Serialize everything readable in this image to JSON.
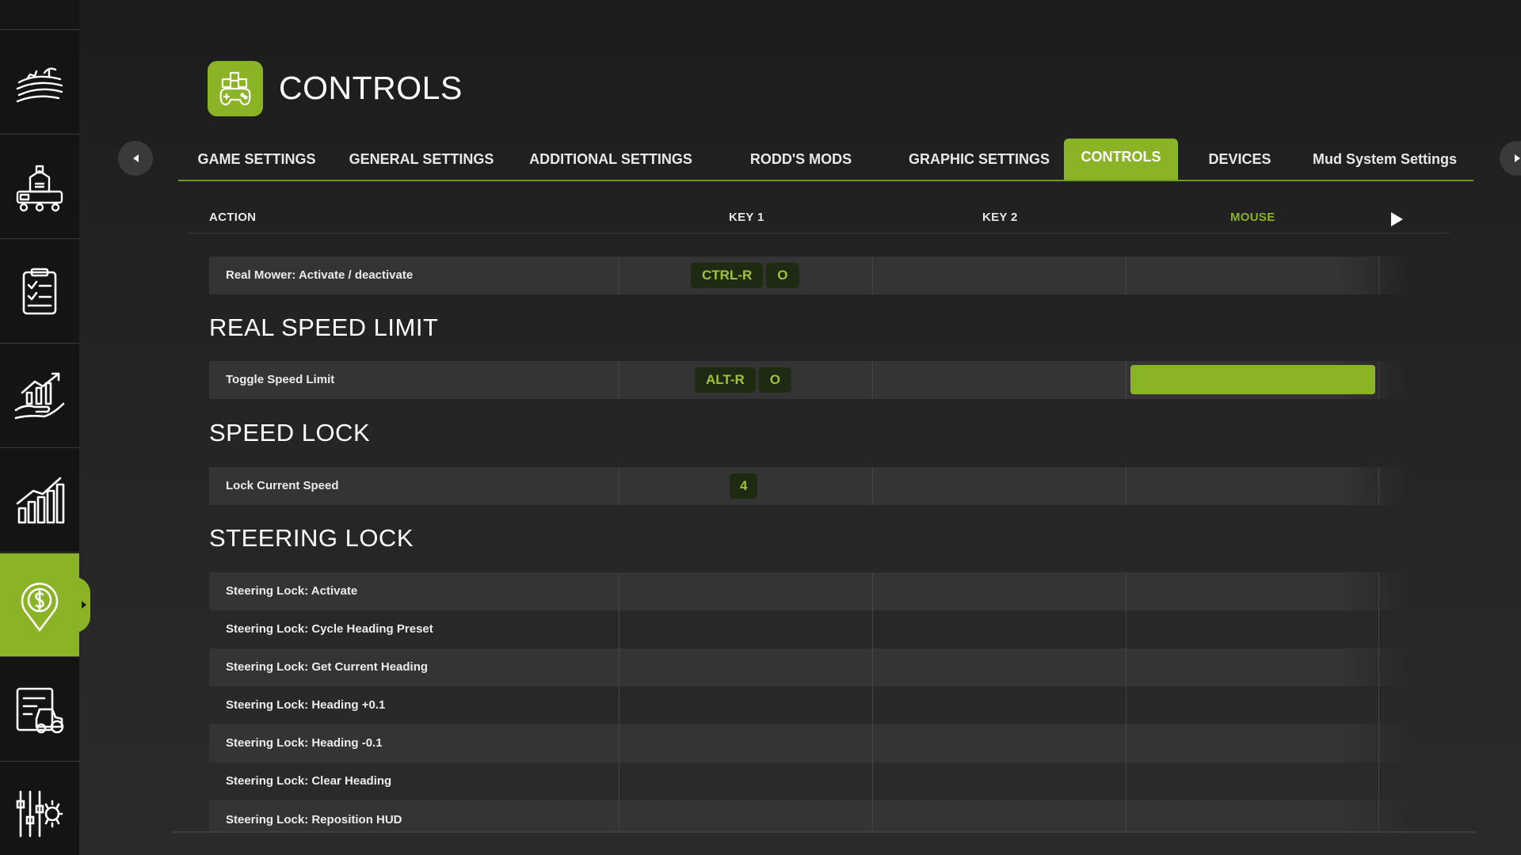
{
  "header": {
    "title": "CONTROLS",
    "icon": "gamepad-icon"
  },
  "sidebar": {
    "items": [
      {
        "name": "farmland-icon"
      },
      {
        "name": "production-icon"
      },
      {
        "name": "contracts-icon"
      },
      {
        "name": "finance-hand-icon"
      },
      {
        "name": "statistics-icon"
      },
      {
        "name": "map-price-icon",
        "active": true
      },
      {
        "name": "vehicle-list-icon"
      },
      {
        "name": "settings-sliders-icon"
      }
    ]
  },
  "tabs": [
    {
      "label": "GAME SETTINGS"
    },
    {
      "label": "GENERAL SETTINGS"
    },
    {
      "label": "ADDITIONAL SETTINGS"
    },
    {
      "label": "RODD'S MODS"
    },
    {
      "label": "GRAPHIC SETTINGS"
    },
    {
      "label": "CONTROLS",
      "active": true
    },
    {
      "label": "DEVICES"
    },
    {
      "label": "Mud System Settings"
    }
  ],
  "columns": {
    "action": "ACTION",
    "key1": "KEY 1",
    "key2": "KEY 2",
    "mouse": "MOUSE"
  },
  "sections": [
    {
      "title": "",
      "rows": [
        {
          "label": "Real Mower: Activate / deactivate",
          "key1": [
            "CTRL-R",
            "O"
          ]
        }
      ]
    },
    {
      "title": "REAL SPEED LIMIT",
      "rows": [
        {
          "label": "Toggle Speed Limit",
          "key1": [
            "ALT-R",
            "O"
          ],
          "mouse_selected": true
        }
      ]
    },
    {
      "title": "SPEED LOCK",
      "rows": [
        {
          "label": "Lock Current Speed",
          "key1": [
            "4"
          ]
        }
      ]
    },
    {
      "title": "STEERING LOCK",
      "rows": [
        {
          "label": "Steering Lock: Activate"
        },
        {
          "label": "Steering Lock: Cycle Heading Preset"
        },
        {
          "label": "Steering Lock: Get Current Heading"
        },
        {
          "label": "Steering Lock: Heading +0.1"
        },
        {
          "label": "Steering Lock: Heading -0.1"
        },
        {
          "label": "Steering Lock: Clear Heading"
        },
        {
          "label": "Steering Lock: Reposition HUD"
        }
      ]
    }
  ],
  "colors": {
    "accent": "#8ab425",
    "key_bg": "#1f2a13",
    "key_text": "#9fc43a"
  }
}
